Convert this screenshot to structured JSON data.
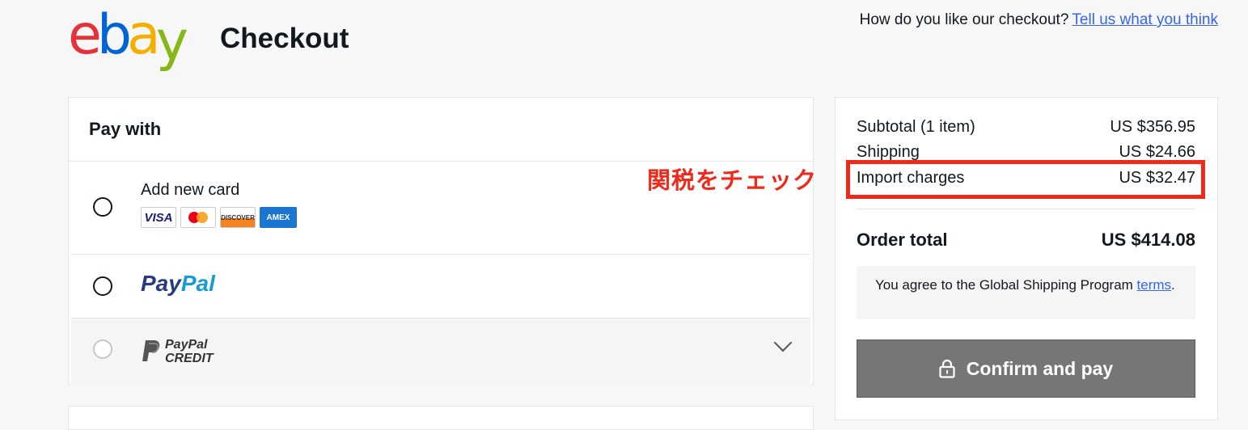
{
  "header": {
    "logo_letters": [
      "e",
      "b",
      "a",
      "y"
    ],
    "title": "Checkout",
    "feedback_question": "How do you like our checkout?",
    "feedback_link": "Tell us what you think"
  },
  "payment": {
    "title": "Pay with",
    "options": {
      "card": {
        "label": "Add new card",
        "logos": [
          "VISA",
          "mastercard",
          "DISCOVER",
          "AMEX"
        ]
      },
      "paypal": {
        "logo_part1": "Pay",
        "logo_part2": "Pal"
      },
      "paypal_credit": {
        "logo_line1": "PayPal",
        "logo_line2": "CREDIT"
      }
    }
  },
  "annotation": {
    "text": "関税をチェック",
    "color": "#f0291b"
  },
  "summary": {
    "subtotal_label": "Subtotal (1 item)",
    "subtotal_value": "US $356.95",
    "shipping_label": "Shipping",
    "shipping_value": "US $24.66",
    "import_label": "Import charges",
    "import_value": "US $32.47",
    "total_label": "Order total",
    "total_value": "US $414.08",
    "agree_text": "You agree to the Global Shipping Program",
    "agree_link": "terms",
    "agree_period": ".",
    "confirm_label": "Confirm and pay"
  },
  "colors": {
    "ebay_red": "#e53238",
    "ebay_blue": "#0064d2",
    "ebay_yellow": "#f5af02",
    "ebay_green": "#86b817",
    "link": "#3665f3",
    "confirm_button": "#767676"
  }
}
